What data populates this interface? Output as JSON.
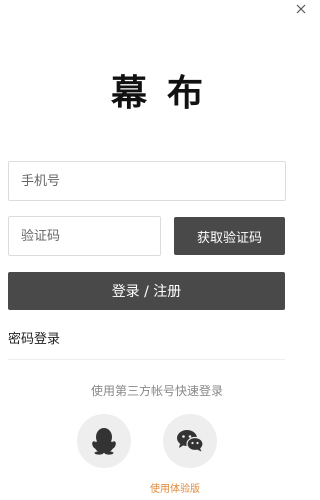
{
  "close": {
    "icon": "close-icon"
  },
  "logo": {
    "text": "幕布"
  },
  "form": {
    "phone_placeholder": "手机号",
    "code_placeholder": "验证码",
    "get_code_label": "获取验证码",
    "submit_label": "登录 / 注册"
  },
  "links": {
    "password_login": "密码登录"
  },
  "third_party": {
    "label": "使用第三方帐号快速登录",
    "providers": [
      {
        "name": "qq",
        "icon": "qq-penguin-icon"
      },
      {
        "name": "wechat",
        "icon": "wechat-icon"
      }
    ],
    "experience_link": "使用体验版"
  },
  "colors": {
    "button_bg": "#4a4949",
    "icon_circle_bg": "#eeeeee",
    "link_accent": "#e08a3a"
  }
}
